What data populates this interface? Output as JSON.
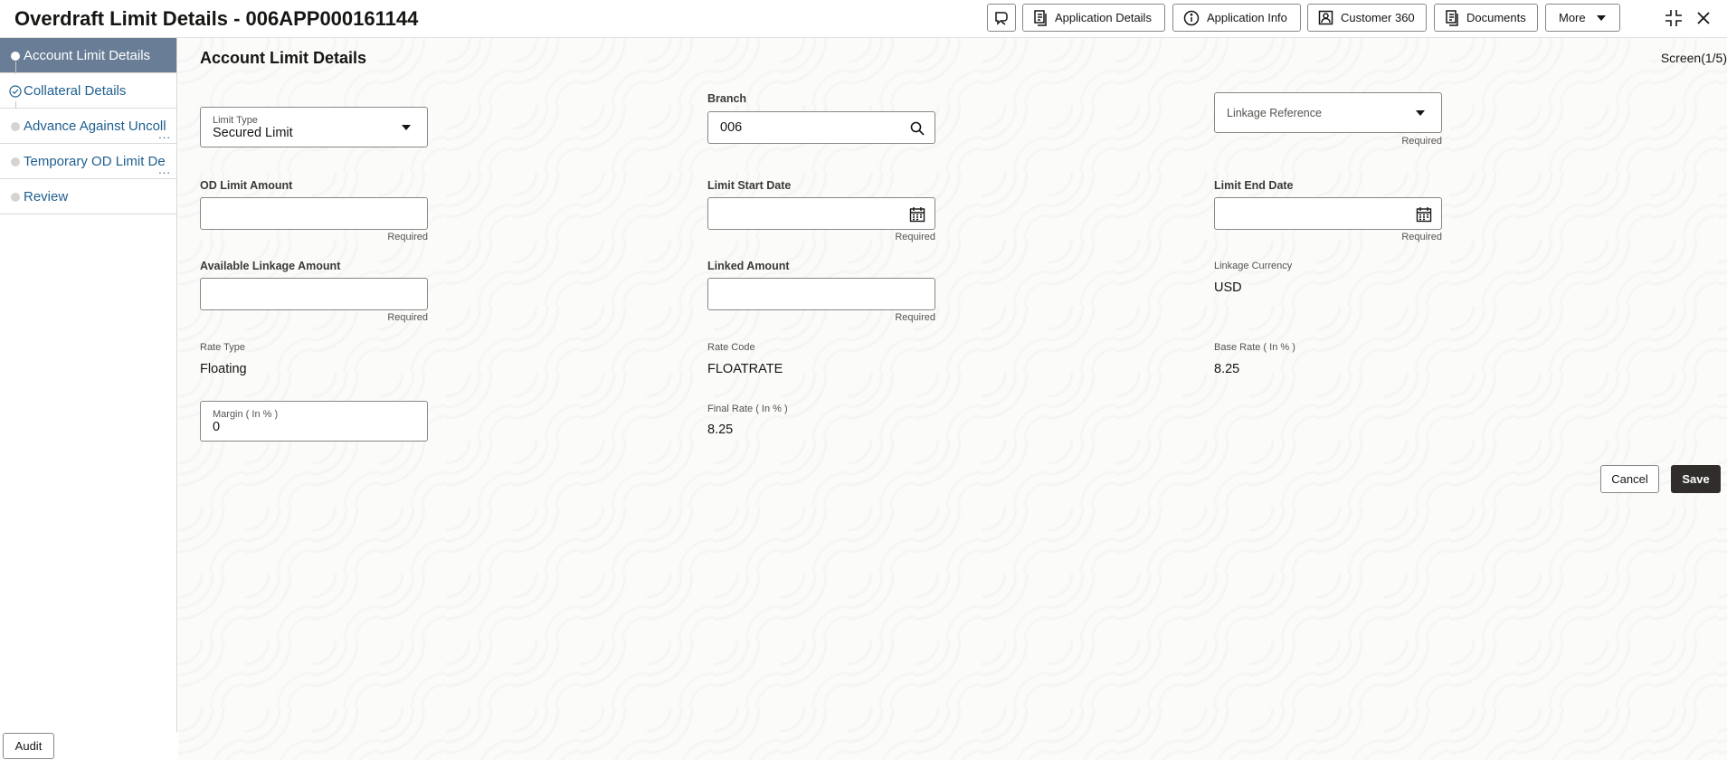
{
  "header": {
    "title": "Overdraft Limit Details - 006APP000161144",
    "buttons": {
      "application_details": "Application Details",
      "application_info": "Application Info",
      "customer_360": "Customer 360",
      "documents": "Documents",
      "more": "More"
    },
    "icons": [
      "chat-icon",
      "document-icon",
      "info-icon",
      "person-card-icon",
      "documents-icon",
      "chevron-down-icon",
      "minimize-icon",
      "close-icon"
    ]
  },
  "sidebar": {
    "items": [
      {
        "label": "Account Limit Details",
        "state": "active"
      },
      {
        "label": "Collateral Details",
        "state": "done"
      },
      {
        "label": "Advance Against Uncoll",
        "state": "pending"
      },
      {
        "label": "Temporary OD Limit De",
        "state": "pending"
      },
      {
        "label": "Review",
        "state": "pending"
      }
    ],
    "ellipsis": "..."
  },
  "main": {
    "title": "Account Limit Details",
    "screen": "Screen(1/5)",
    "required": "Required",
    "fields": {
      "limit_type": {
        "label": "Limit Type",
        "value": "Secured Limit"
      },
      "branch": {
        "label": "Branch",
        "value": "006"
      },
      "linkage_reference": {
        "label": "Linkage Reference",
        "value": ""
      },
      "od_limit_amount": {
        "label": "OD Limit Amount",
        "value": ""
      },
      "limit_start_date": {
        "label": "Limit Start Date",
        "value": ""
      },
      "limit_end_date": {
        "label": "Limit End Date",
        "value": ""
      },
      "available_linkage_amount": {
        "label": "Available Linkage Amount",
        "value": ""
      },
      "linked_amount": {
        "label": "Linked Amount",
        "value": ""
      },
      "linkage_currency": {
        "label": "Linkage Currency",
        "value": "USD"
      },
      "rate_type": {
        "label": "Rate Type",
        "value": "Floating"
      },
      "rate_code": {
        "label": "Rate Code",
        "value": "FLOATRATE"
      },
      "base_rate": {
        "label": "Base Rate ( In % )",
        "value": "8.25"
      },
      "margin": {
        "label": "Margin ( In % )",
        "value": "0"
      },
      "final_rate": {
        "label": "Final Rate ( In % )",
        "value": "8.25"
      }
    },
    "actions": {
      "cancel": "Cancel",
      "save": "Save"
    }
  },
  "footer": {
    "audit": "Audit"
  },
  "colors": {
    "sidebar_active": "#697d96",
    "link": "#1f5f8f",
    "save_bg": "#312d2a"
  }
}
